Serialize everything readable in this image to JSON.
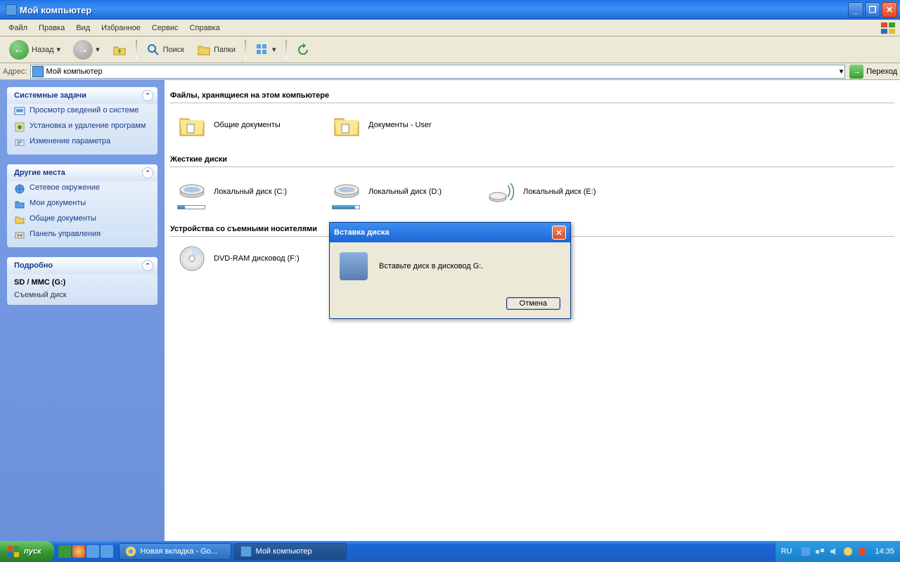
{
  "titlebar": {
    "title": "Мой компьютер"
  },
  "menu": {
    "file": "Файл",
    "edit": "Правка",
    "view": "Вид",
    "fav": "Избранное",
    "tools": "Сервис",
    "help": "Справка"
  },
  "toolbar": {
    "back": "Назад",
    "search": "Поиск",
    "folders": "Папки"
  },
  "address": {
    "label": "Адрес:",
    "value": "Мой компьютер",
    "go": "Переход"
  },
  "sidebar": {
    "tasks": {
      "title": "Системные задачи",
      "items": [
        "Просмотр сведений о системе",
        "Установка и удаление программ",
        "Изменение параметра"
      ]
    },
    "places": {
      "title": "Другие места",
      "items": [
        "Сетевое окружение",
        "Мои документы",
        "Общие документы",
        "Панель управления"
      ]
    },
    "details": {
      "title": "Подробно",
      "heading": "SD / MMC (G:)",
      "sub": "Съемный диск"
    }
  },
  "content": {
    "g1": {
      "title": "Файлы, хранящиеся на этом компьютере",
      "i0": "Общие документы",
      "i1": "Документы - User"
    },
    "g2": {
      "title": "Жесткие диски",
      "i0": "Локальный диск (C:)",
      "i1": "Локальный диск (D:)",
      "i2": "Локальный диск (E:)"
    },
    "g3": {
      "title": "Устройства со съемными носителями",
      "i0": "DVD-RAM дисковод (F:)"
    }
  },
  "dialog": {
    "title": "Вставка диска",
    "msg": "Вставьте диск в дисковод G:.",
    "cancel": "Отмена"
  },
  "taskbar": {
    "start": "пуск",
    "task0": "Новая вкладка - Go...",
    "task1": "Мой компьютер",
    "lang": "RU",
    "clock": "14:35"
  }
}
